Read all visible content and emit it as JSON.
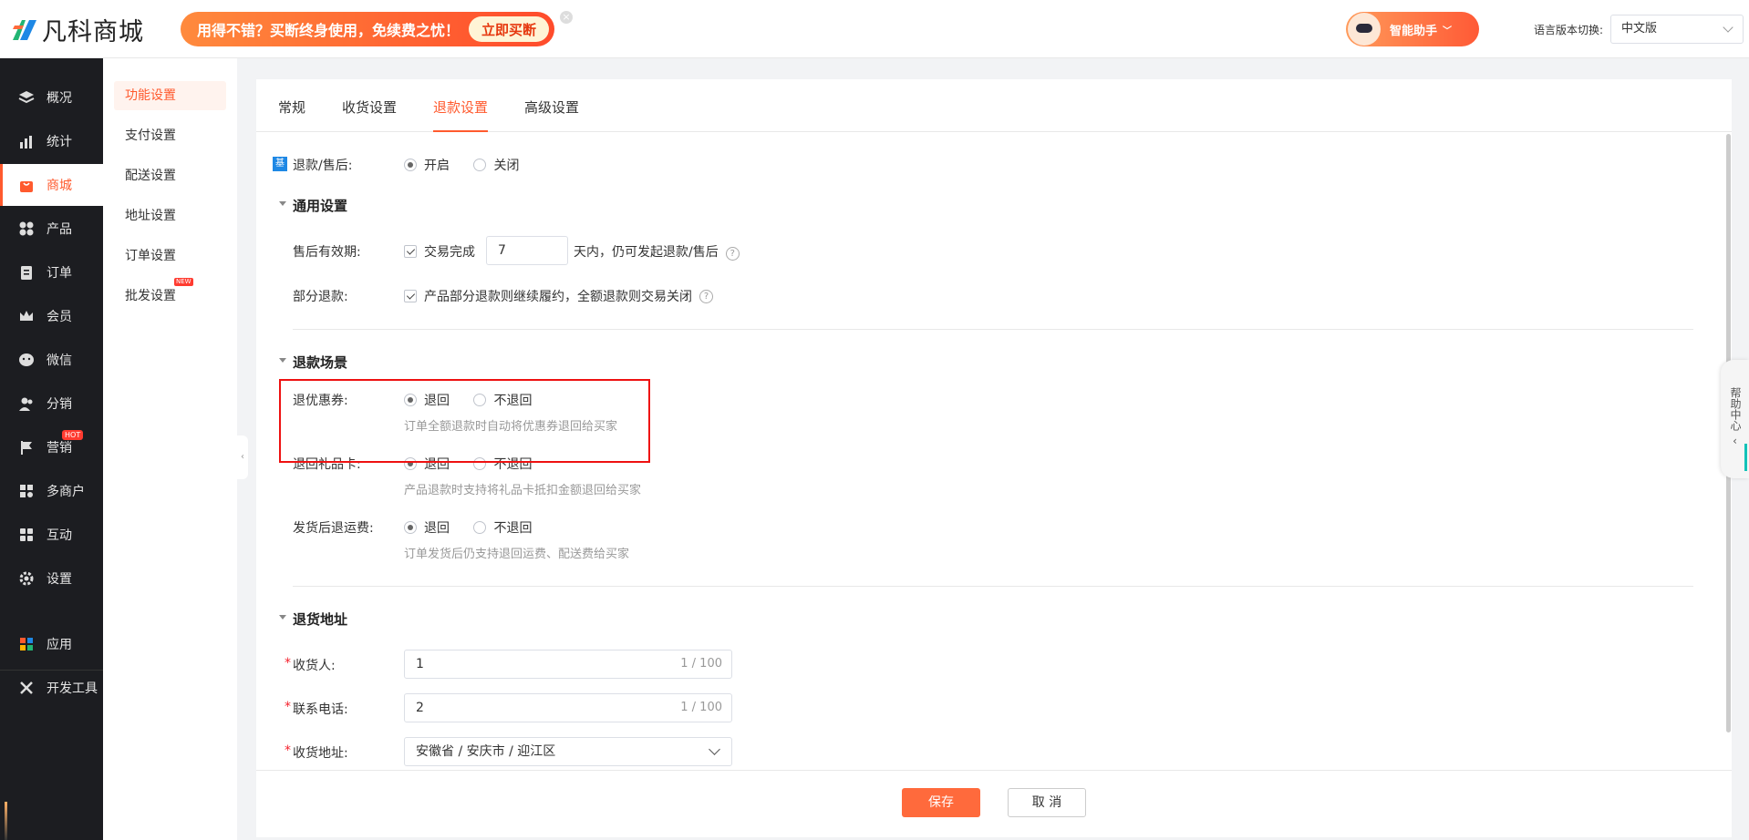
{
  "brand": {
    "name": "凡科商城"
  },
  "promo": {
    "text": "用得不错？买断终身使用，免续费之忧！",
    "button": "立即买断",
    "close": "×"
  },
  "assistant": {
    "label": "智能助手"
  },
  "language": {
    "label": "语言版本切换:",
    "value": "中文版"
  },
  "sidebar": {
    "items": [
      {
        "label": "概况",
        "icon": "layers-icon"
      },
      {
        "label": "统计",
        "icon": "chart-icon"
      },
      {
        "label": "商城",
        "icon": "shop-bag-icon",
        "active": true
      },
      {
        "label": "产品",
        "icon": "grid-icon"
      },
      {
        "label": "订单",
        "icon": "clipboard-icon"
      },
      {
        "label": "会员",
        "icon": "crown-icon"
      },
      {
        "label": "微信",
        "icon": "wechat-icon"
      },
      {
        "label": "分销",
        "icon": "users-icon"
      },
      {
        "label": "营销",
        "icon": "flag-icon",
        "badge": "HOT"
      },
      {
        "label": "多商户",
        "icon": "store-icon"
      },
      {
        "label": "互动",
        "icon": "interact-icon"
      },
      {
        "label": "设置",
        "icon": "gear-icon"
      },
      {
        "label": "应用",
        "icon": "apps-icon"
      },
      {
        "label": "开发工具",
        "icon": "tools-icon"
      }
    ]
  },
  "subnav": {
    "items": [
      {
        "label": "功能设置",
        "active": true
      },
      {
        "label": "支付设置"
      },
      {
        "label": "配送设置"
      },
      {
        "label": "地址设置"
      },
      {
        "label": "订单设置"
      },
      {
        "label": "批发设置",
        "badge": "NEW"
      }
    ]
  },
  "tabs": [
    {
      "label": "常规"
    },
    {
      "label": "收货设置"
    },
    {
      "label": "退款设置",
      "active": true
    },
    {
      "label": "高级设置"
    }
  ],
  "refund": {
    "tag": "基",
    "label": "退款/售后:",
    "options": [
      "开启",
      "关闭"
    ],
    "selected": "开启"
  },
  "general": {
    "title": "通用设置",
    "validity": {
      "label": "售后有效期:",
      "check": "交易完成",
      "days": "7",
      "suffix": "天内，仍可发起退款/售后"
    },
    "partial": {
      "label": "部分退款:",
      "check": "产品部分退款则继续履约，全额退款则交易关闭"
    }
  },
  "scenarios": {
    "title": "退款场景",
    "coupon": {
      "label": "退优惠券:",
      "opt1": "退回",
      "opt2": "不退回",
      "hint": "订单全额退款时自动将优惠券退回给买家"
    },
    "giftcard": {
      "label": "退回礼品卡:",
      "opt1": "退回",
      "opt2": "不退回",
      "hint": "产品退款时支持将礼品卡抵扣金额退回给买家"
    },
    "shipping": {
      "label": "发货后退运费:",
      "opt1": "退回",
      "opt2": "不退回",
      "hint": "订单发货后仍支持退回运费、配送费给买家"
    }
  },
  "address": {
    "title": "退货地址",
    "receiver": {
      "label": "收货人:",
      "value": "1",
      "count": "1 / 100"
    },
    "phone": {
      "label": "联系电话:",
      "value": "2",
      "count": "1 / 100"
    },
    "region": {
      "label": "收货地址:",
      "value": "安徽省 / 安庆市 / 迎江区"
    }
  },
  "footer": {
    "save": "保存",
    "cancel": "取 消"
  },
  "helpdesk": {
    "label": "帮助中心"
  },
  "colors": {
    "accent": "#ff5a2e",
    "sidebar": "#1c1d21",
    "highlight": "#e11111"
  }
}
